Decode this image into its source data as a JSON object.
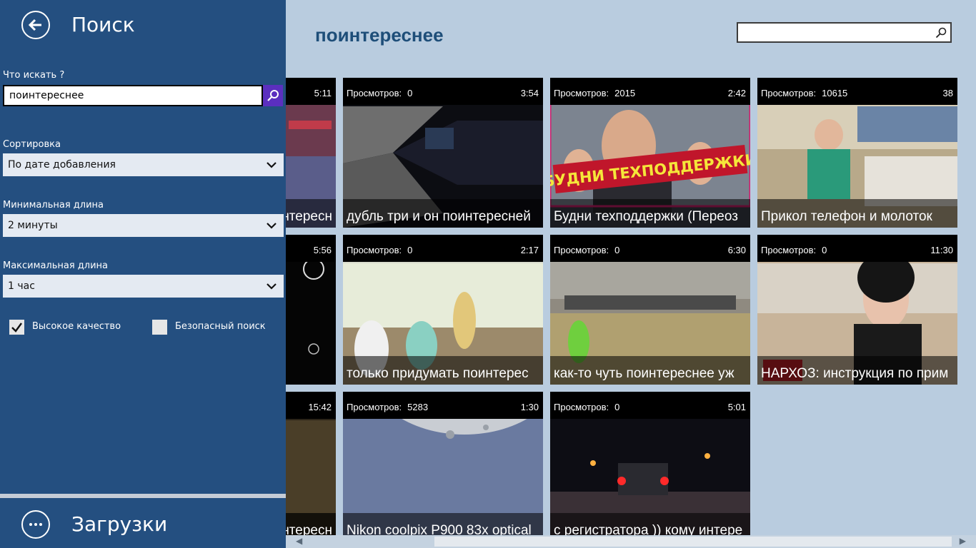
{
  "header": {
    "title": "поинтереснее"
  },
  "search": {
    "value": ""
  },
  "panel": {
    "title": "Поиск",
    "query_label": "Что искать ?",
    "query_value": "поинтереснее",
    "sort_label": "Сортировка",
    "sort_value": "По дате добавления",
    "min_label": "Минимальная длина",
    "min_value": "2 минуты",
    "max_label": "Максимальная длина",
    "max_value": "1 час",
    "hq_label": "Высокое качество",
    "hq_checked": true,
    "safe_label": "Безопасный поиск",
    "safe_checked": false,
    "downloads_label": "Загрузки"
  },
  "videos": [
    {
      "views_label": "",
      "views": "",
      "duration": "5:11",
      "title": "нтересн"
    },
    {
      "views_label": "Просмотров:",
      "views": "0",
      "duration": "3:54",
      "title": "дубль три и он поинтересней"
    },
    {
      "views_label": "Просмотров:",
      "views": "2015",
      "duration": "2:42",
      "title": "Будни техподдержки (Переоз"
    },
    {
      "views_label": "Просмотров:",
      "views": "10615",
      "duration": "38",
      "title": "Прикол телефон и молоток"
    },
    {
      "views_label": "",
      "views": "",
      "duration": "5:56",
      "title": ""
    },
    {
      "views_label": "Просмотров:",
      "views": "0",
      "duration": "2:17",
      "title": "только придумать поинтерес"
    },
    {
      "views_label": "Просмотров:",
      "views": "0",
      "duration": "6:30",
      "title": "как-то чуть поинтереснее уж"
    },
    {
      "views_label": "Просмотров:",
      "views": "0",
      "duration": "11:30",
      "title": "НАРХОЗ: инструкция по прим"
    },
    {
      "views_label": "",
      "views": "",
      "duration": "15:42",
      "title": "нтересн"
    },
    {
      "views_label": "Просмотров:",
      "views": "5283",
      "duration": "1:30",
      "title": "Nikon coolpix P900 83x optical"
    },
    {
      "views_label": "Просмотров:",
      "views": "0",
      "duration": "5:01",
      "title": "с регистратора )) кому интере"
    }
  ],
  "thumb_overlay_text": "БУДНИ ТЕХПОДДЕРЖКИ",
  "colors": {
    "panel": "#244f80",
    "accent": "#5b2fbf",
    "background": "#b9ccdf"
  }
}
